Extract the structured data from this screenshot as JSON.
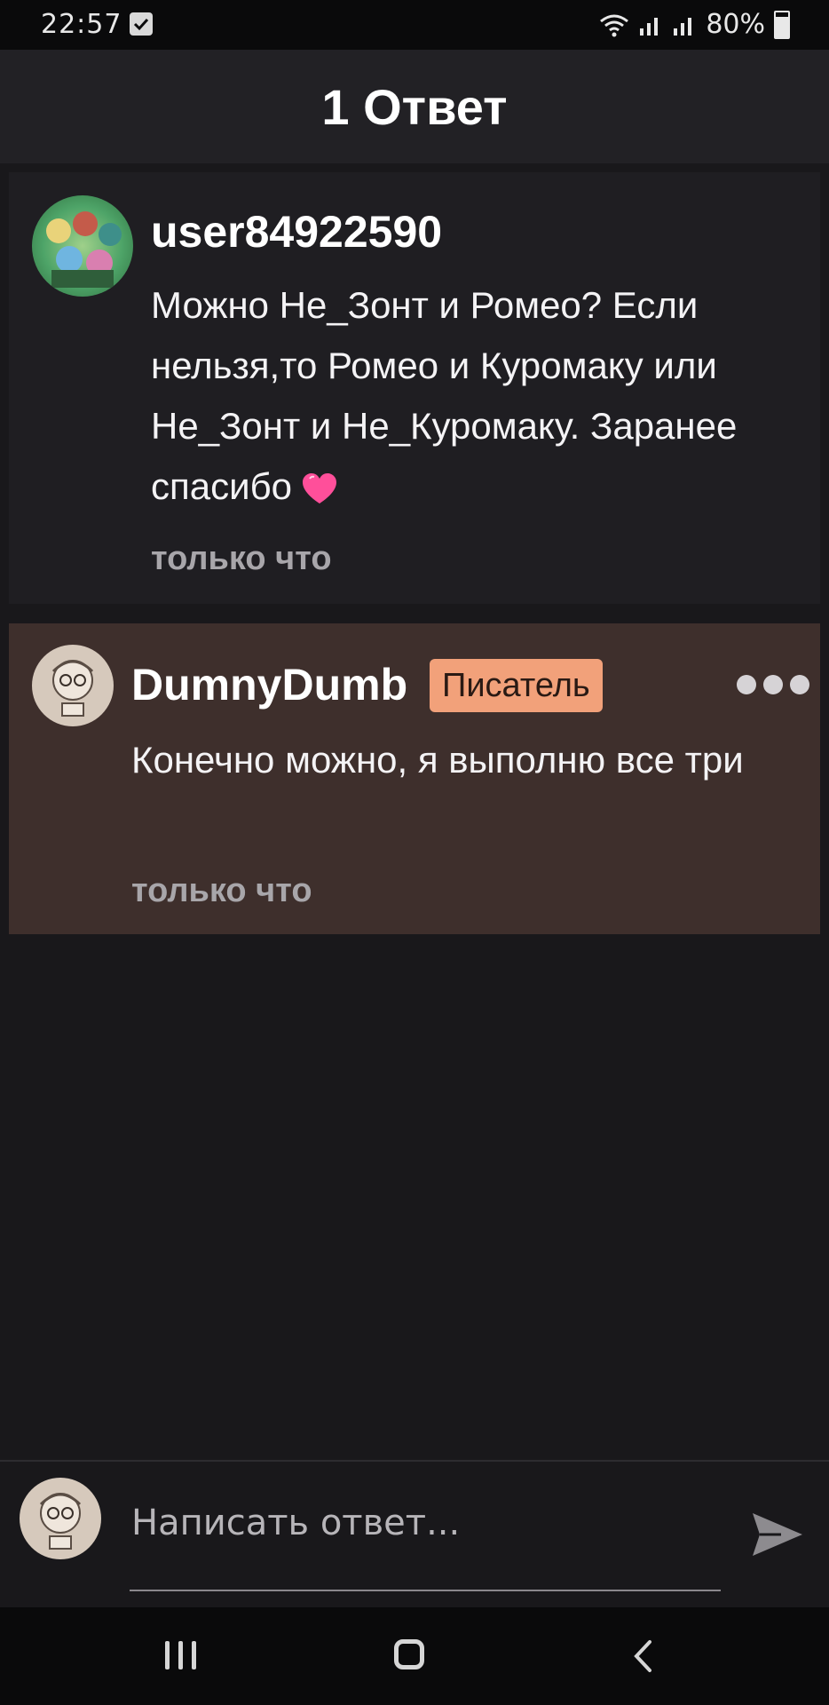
{
  "status_bar": {
    "time": "22:57",
    "battery": "80%"
  },
  "header": {
    "title": "1 Ответ"
  },
  "original_comment": {
    "username": "user84922590",
    "text": "Можно Не_Зонт и Ромео? Если нельзя,то Ромео и Куромаку или Не_Зонт и Не_Куромаку. Заранее спасибо",
    "emoji": "heart-icon",
    "timestamp": "только что"
  },
  "reply": {
    "username": "DumnyDumb",
    "role_badge": "Писатель",
    "text": "Конечно можно, я выполню все три",
    "timestamp": "только что"
  },
  "composer": {
    "placeholder": "Написать ответ..."
  },
  "colors": {
    "background": "#19181b",
    "card": "#1f1e22",
    "reply_card": "#3e2f2c",
    "badge": "#f2a17a"
  }
}
